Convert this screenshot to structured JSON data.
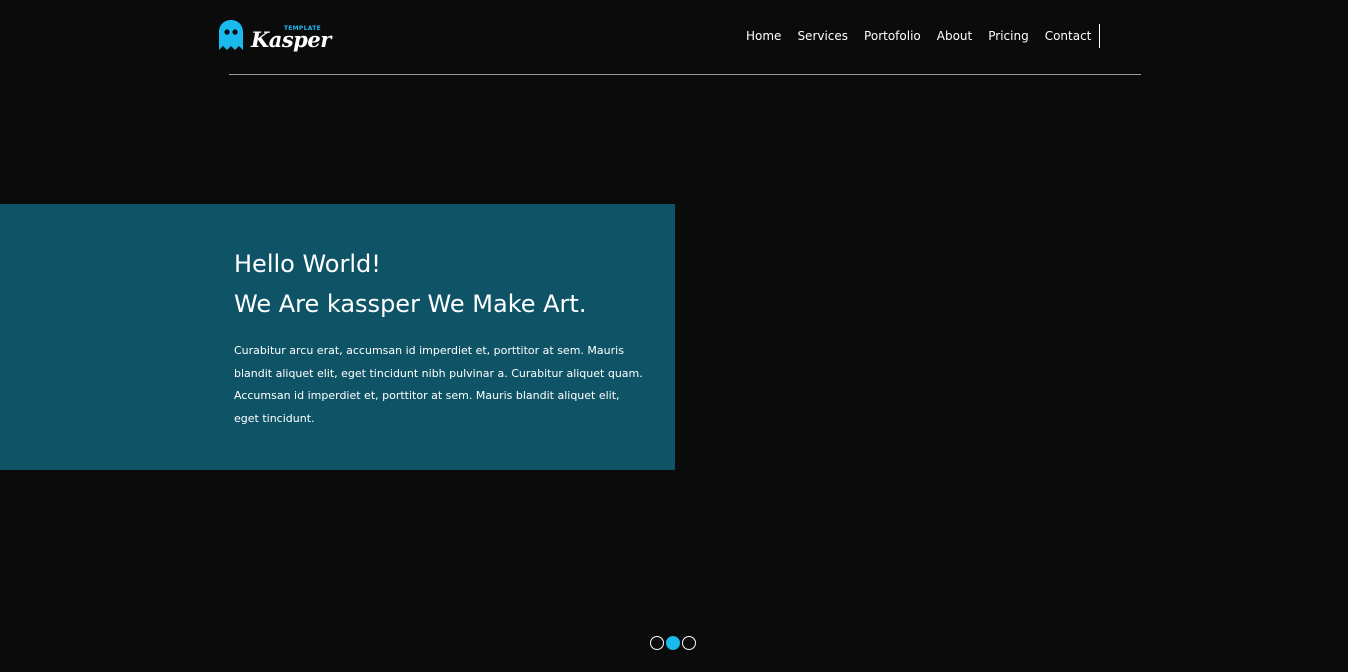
{
  "brand": {
    "tag": "TEMPLATE",
    "name": "Kasper",
    "accent_color": "#1ab9ee",
    "icon": "ghost-icon"
  },
  "nav": {
    "items": [
      {
        "label": "Home"
      },
      {
        "label": "Services"
      },
      {
        "label": "Portofolio"
      },
      {
        "label": "About"
      },
      {
        "label": "Pricing"
      },
      {
        "label": "Contact"
      }
    ]
  },
  "hero": {
    "title_line1": "Hello World!",
    "title_line2": "We Are kassper We Make Art.",
    "paragraph": "Curabitur arcu erat, accumsan id imperdiet et, porttitor at sem. Mauris blandit aliquet elit, eget tincidunt nibh pulvinar a. Curabitur aliquet quam. Accumsan id imperdiet et, porttitor at sem. Mauris blandit aliquet elit, eget tincidunt.",
    "background_color": "#0f5466"
  },
  "slider": {
    "bullet_count": 3,
    "active_index": 1
  },
  "colors": {
    "page_background": "#0b0b0b",
    "text": "#ffffff"
  }
}
